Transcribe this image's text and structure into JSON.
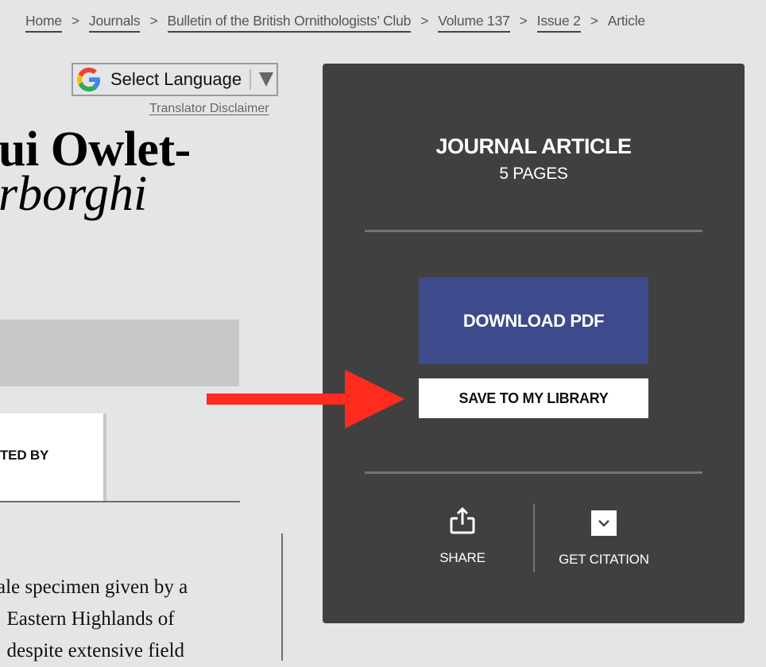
{
  "breadcrumb": {
    "items": [
      {
        "label": "Home"
      },
      {
        "label": "Journals"
      },
      {
        "label": "Bulletin of the British Ornithologists’ Club"
      },
      {
        "label": "Volume 137"
      },
      {
        "label": "Issue 2"
      }
    ],
    "current": "Article",
    "separator": ">"
  },
  "translator": {
    "select_label": "Select Language",
    "disclaimer": "Translator Disclaimer",
    "icon": "google-g-icon"
  },
  "article": {
    "title_line1": "ui Owlet-",
    "title_line2": "rborghi",
    "tab_label": "TED BY",
    "abstract_lines": [
      "ale specimen given by a",
      "  Eastern Highlands of",
      "  despite extensive field"
    ]
  },
  "panel": {
    "type_label": "JOURNAL ARTICLE",
    "pages_label": "5 PAGES",
    "download_label": "DOWNLOAD PDF",
    "save_label": "SAVE TO MY LIBRARY",
    "share_label": "SHARE",
    "share_icon": "share-icon",
    "citation_label": "GET CITATION",
    "citation_icon": "chevron-down-icon"
  },
  "colors": {
    "page_bg": "#e4e5e7",
    "panel_bg": "#404040",
    "download_bg": "#3d4a8c",
    "annotation_arrow": "#fe2b1f"
  }
}
